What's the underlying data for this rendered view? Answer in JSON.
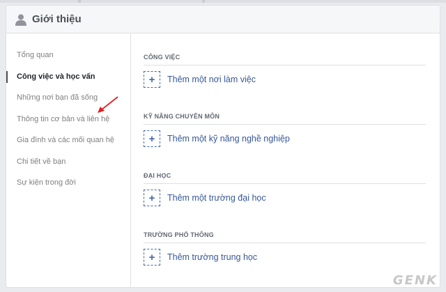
{
  "header": {
    "title": "Giới thiệu",
    "icon": "person-icon"
  },
  "sidebar": {
    "items": [
      {
        "label": "Tổng quan",
        "active": false
      },
      {
        "label": "Công việc và học vấn",
        "active": true
      },
      {
        "label": "Những nơi bạn đã sống",
        "active": false
      },
      {
        "label": "Thông tin cơ bản và liên hệ",
        "active": false
      },
      {
        "label": "Gia đình và các mối quan hệ",
        "active": false
      },
      {
        "label": "Chi tiết về bạn",
        "active": false
      },
      {
        "label": "Sự kiện trong đời",
        "active": false
      }
    ]
  },
  "sections": [
    {
      "title": "CÔNG VIỆC",
      "add_label": "Thêm một nơi làm việc"
    },
    {
      "title": "KỸ NĂNG CHUYÊN MÔN",
      "add_label": "Thêm một kỹ năng nghề nghiệp"
    },
    {
      "title": "ĐẠI HỌC",
      "add_label": "Thêm một trường đại học"
    },
    {
      "title": "TRƯỜNG PHỔ THÔNG",
      "add_label": "Thêm trường trung học"
    }
  ],
  "colors": {
    "link": "#365899",
    "accent": "#4267b2",
    "arrow": "#e02020"
  },
  "watermark": "GENK"
}
